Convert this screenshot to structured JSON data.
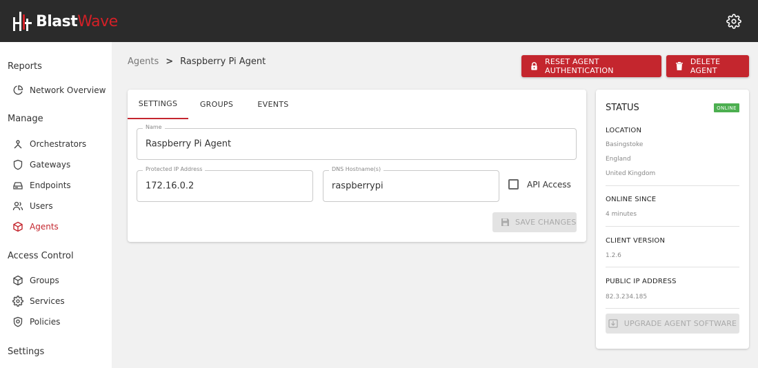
{
  "brand": {
    "name_part1": "Blast",
    "name_part2": "Wave",
    "accent": "#c4262e",
    "dark": "#2b2b2b"
  },
  "topbar": {
    "settings_icon": "gear-icon"
  },
  "sidebar": {
    "sections": {
      "reports": "Reports",
      "manage": "Manage",
      "access_control": "Access Control",
      "settings": "Settings"
    },
    "items": {
      "network_overview": {
        "label": "Network Overview",
        "icon": "pie-chart-icon"
      },
      "orchestrators": {
        "label": "Orchestrators",
        "icon": "hub-icon"
      },
      "gateways": {
        "label": "Gateways",
        "icon": "shield-icon"
      },
      "endpoints": {
        "label": "Endpoints",
        "icon": "drive-icon"
      },
      "users": {
        "label": "Users",
        "icon": "users-icon"
      },
      "agents": {
        "label": "Agents",
        "icon": "cube-icon",
        "active": true
      },
      "groups": {
        "label": "Groups",
        "icon": "box-icon"
      },
      "services": {
        "label": "Services",
        "icon": "gear-icon"
      },
      "policies": {
        "label": "Policies",
        "icon": "policy-icon"
      }
    }
  },
  "breadcrumb": {
    "parent": "Agents",
    "separator": ">",
    "current": "Raspberry Pi Agent"
  },
  "actions": {
    "reset_auth": "RESET AGENT AUTHENTICATION",
    "delete_agent": "DELETE AGENT"
  },
  "tabs": {
    "settings": "SETTINGS",
    "groups": "GROUPS",
    "events": "EVENTS",
    "active": "settings"
  },
  "form": {
    "name": {
      "label": "Name",
      "value": "Raspberry Pi Agent"
    },
    "protected_ip": {
      "label": "Protected IP Address",
      "value": "172.16.0.2"
    },
    "dns_hostname": {
      "label": "DNS Hostname(s)",
      "value": "raspberrypi"
    },
    "api_access": {
      "label": "API Access",
      "checked": false
    },
    "save_label": "SAVE CHANGES"
  },
  "status": {
    "title": "STATUS",
    "badge": "ONLINE",
    "location": {
      "label": "LOCATION",
      "city": "Basingstoke",
      "region": "England",
      "country": "United Kingdom"
    },
    "online_since": {
      "label": "ONLINE SINCE",
      "value": "4 minutes"
    },
    "client_version": {
      "label": "CLIENT VERSION",
      "value": "1.2.6"
    },
    "public_ip": {
      "label": "PUBLIC IP ADDRESS",
      "value": "82.3.234.185"
    },
    "upgrade_label": "UPGRADE AGENT SOFTWARE"
  }
}
